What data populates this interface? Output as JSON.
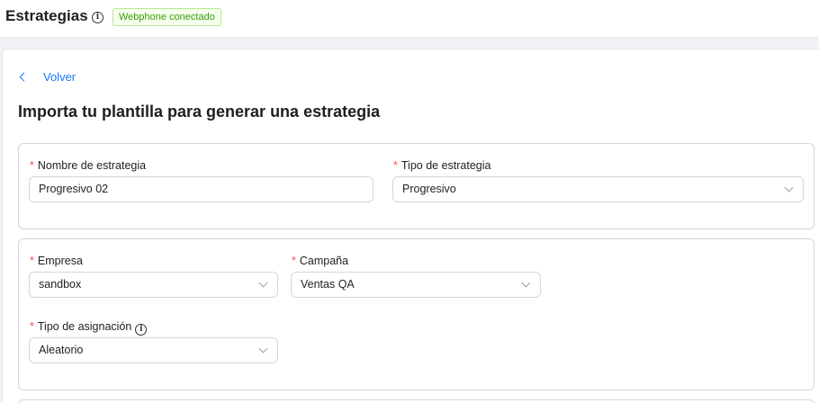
{
  "header": {
    "title": "Estrategias",
    "status_badge": "Webphone conectado"
  },
  "nav": {
    "back_label": "Volver"
  },
  "main": {
    "heading": "Importa tu plantilla para generar una estrategia"
  },
  "form": {
    "required_mark": "*",
    "strategy_name": {
      "label": "Nombre de estrategia",
      "value": "Progresivo 02"
    },
    "strategy_type": {
      "label": "Tipo de estrategia",
      "value": "Progresivo"
    },
    "company": {
      "label": "Empresa",
      "value": "sandbox"
    },
    "campaign": {
      "label": "Campaña",
      "value": "Ventas QA"
    },
    "assignment_type": {
      "label": "Tipo de asignación",
      "value": "Aleatorio"
    }
  },
  "icons": {
    "info": "info-circle-icon",
    "back": "chevron-left-icon",
    "select": "chevron-down-icon"
  },
  "colors": {
    "accent": "#1677ff",
    "required": "#ff4d4f",
    "badge_text": "#389e0d",
    "badge_bg": "#f6ffed",
    "badge_border": "#b7eb8f"
  }
}
